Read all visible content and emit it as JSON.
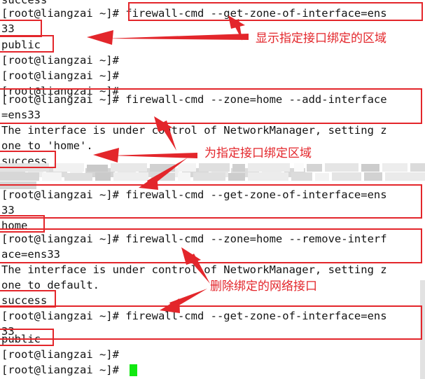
{
  "window": {
    "kind": "terminal-session",
    "background": "#ffffff",
    "foreground": "#141414",
    "cursor_color": "#10e810",
    "annotation_color": "#e3262b"
  },
  "terminal": {
    "prompt": "[root@liangzai ~]#",
    "partial_top_line": "success",
    "lines": [
      {
        "id": 0,
        "text": "[root@liangzai ~]# firewall-cmd --get-zone-of-interface=ens",
        "boxed": true
      },
      {
        "id": 1,
        "text": "33",
        "boxed": true
      },
      {
        "id": 2,
        "text": "public",
        "boxed": true
      },
      {
        "id": 3,
        "text": "[root@liangzai ~]#",
        "boxed": false
      },
      {
        "id": 4,
        "text": "[root@liangzai ~]#",
        "boxed": false
      },
      {
        "id": 5,
        "text": "[root@liangzai ~]#",
        "boxed": false
      },
      {
        "id": 6,
        "text": "[root@liangzai ~]# firewall-cmd --zone=home --add-interface",
        "boxed": true
      },
      {
        "id": 7,
        "text": "=ens33",
        "boxed": true
      },
      {
        "id": 8,
        "text": "The interface is under control of NetworkManager, setting z",
        "boxed": false
      },
      {
        "id": 9,
        "text": "one to 'home'.",
        "boxed": false
      },
      {
        "id": 10,
        "text": "success",
        "boxed": true
      },
      {
        "id": 11,
        "text": "",
        "boxed": false,
        "censored": true
      },
      {
        "id": 12,
        "text": "",
        "boxed": false,
        "censored": true
      },
      {
        "id": 13,
        "text": "[root@liangzai ~]# firewall-cmd --get-zone-of-interface=ens",
        "boxed": true
      },
      {
        "id": 14,
        "text": "33",
        "boxed": true
      },
      {
        "id": 15,
        "text": "home",
        "boxed": true
      },
      {
        "id": 16,
        "text": "[root@liangzai ~]# firewall-cmd --zone=home --remove-interf",
        "boxed": true
      },
      {
        "id": 17,
        "text": "ace=ens33",
        "boxed": true
      },
      {
        "id": 18,
        "text": "The interface is under control of NetworkManager, setting z",
        "boxed": false
      },
      {
        "id": 19,
        "text": "one to default.",
        "boxed": false
      },
      {
        "id": 20,
        "text": "success",
        "boxed": true
      },
      {
        "id": 21,
        "text": "[root@liangzai ~]# firewall-cmd --get-zone-of-interface=ens",
        "boxed": true
      },
      {
        "id": 22,
        "text": "33",
        "boxed": true
      },
      {
        "id": 23,
        "text": "public",
        "boxed": true
      },
      {
        "id": 24,
        "text": "[root@liangzai ~]#",
        "boxed": false
      },
      {
        "id": 25,
        "text": "[root@liangzai ~]#",
        "boxed": false,
        "cursor": true
      }
    ]
  },
  "annotations": [
    {
      "id": "a1",
      "text": "显示指定接口绑定的区域",
      "describes": "firewall-cmd --get-zone-of-interface=ens33"
    },
    {
      "id": "a2",
      "text": "为指定接口绑定区域",
      "describes": "firewall-cmd --zone=home --add-interface=ens33"
    },
    {
      "id": "a3",
      "text": "删除绑定的网络接口",
      "describes": "firewall-cmd --zone=home --remove-interface=ens33"
    }
  ]
}
